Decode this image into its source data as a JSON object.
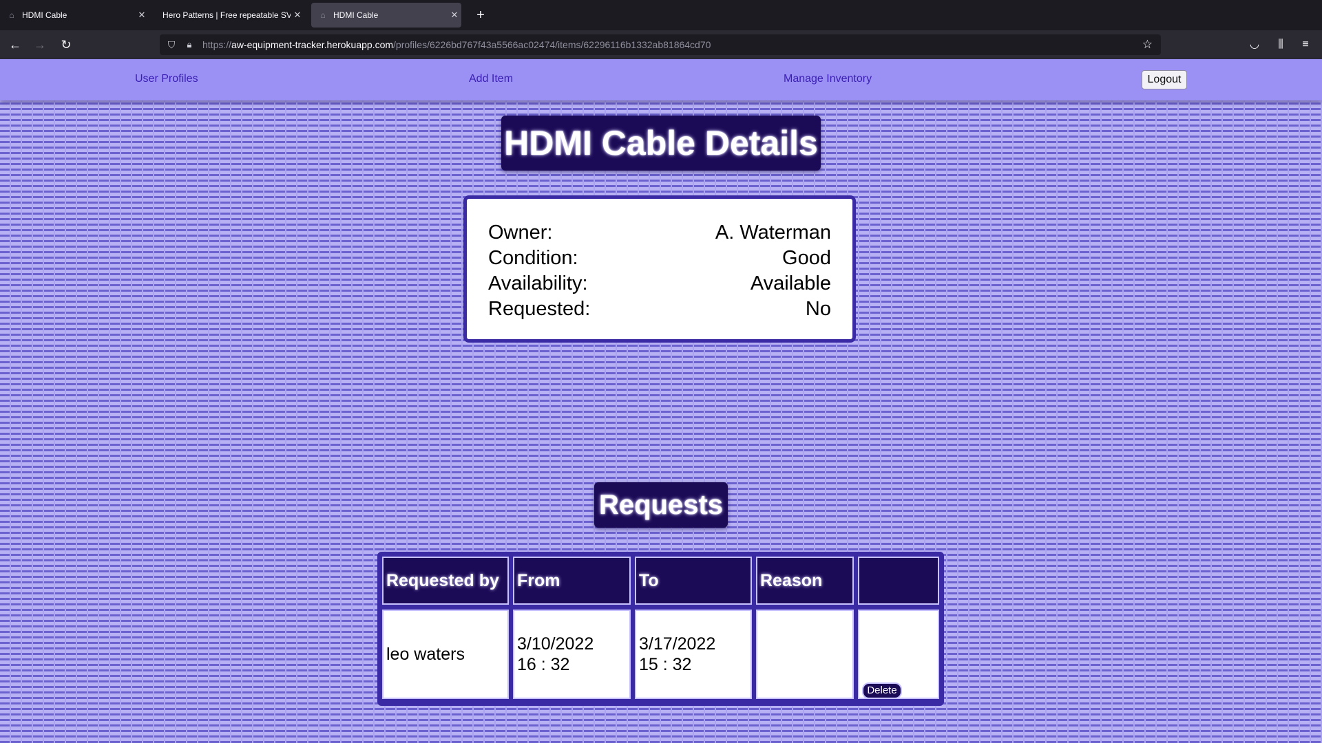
{
  "browser": {
    "tabs": [
      {
        "title": "HDMI Cable",
        "active": false
      },
      {
        "title": "Hero Patterns | Free repeatable SVG",
        "active": false
      },
      {
        "title": "HDMI Cable",
        "active": true
      }
    ],
    "url_prefix": "https://",
    "url_host": "aw-equipment-tracker.herokuapp.com",
    "url_path": "/profiles/6226bd767f43a5566ac02474/items/62296116b1332ab81864cd70",
    "icons": {
      "back": "arrow-left-icon",
      "forward": "arrow-right-icon",
      "reload": "reload-icon",
      "shield": "tracking-protection-icon",
      "lock": "lock-icon",
      "bookmark": "star-icon",
      "pocket": "pocket-icon",
      "library": "library-icon",
      "menu": "hamburger-menu-icon",
      "new_tab": "plus-icon",
      "tab_close": "close-icon"
    }
  },
  "nav": {
    "user_profiles": "User Profiles",
    "add_item": "Add Item",
    "manage_inventory": "Manage Inventory",
    "logout": "Logout"
  },
  "item": {
    "title": "HDMI Cable Details",
    "details": [
      {
        "label": "Owner:",
        "value": "A. Waterman"
      },
      {
        "label": "Condition:",
        "value": "Good"
      },
      {
        "label": "Availability:",
        "value": "Available"
      },
      {
        "label": "Requested:",
        "value": "No"
      }
    ]
  },
  "requests": {
    "title": "Requests",
    "headers": [
      "Requested by",
      "From",
      "To",
      "Reason",
      ""
    ],
    "rows": [
      {
        "requested_by": "leo waters",
        "from_date": "3/10/2022",
        "from_time": "16 : 32",
        "to_date": "3/17/2022",
        "to_time": "15 : 32",
        "reason": "",
        "action": "Delete"
      }
    ]
  },
  "colors": {
    "accent": "#1b0a56",
    "nav_bg": "#9b91f5",
    "card_border": "#3a2aa4",
    "link": "#3b1fb3"
  }
}
